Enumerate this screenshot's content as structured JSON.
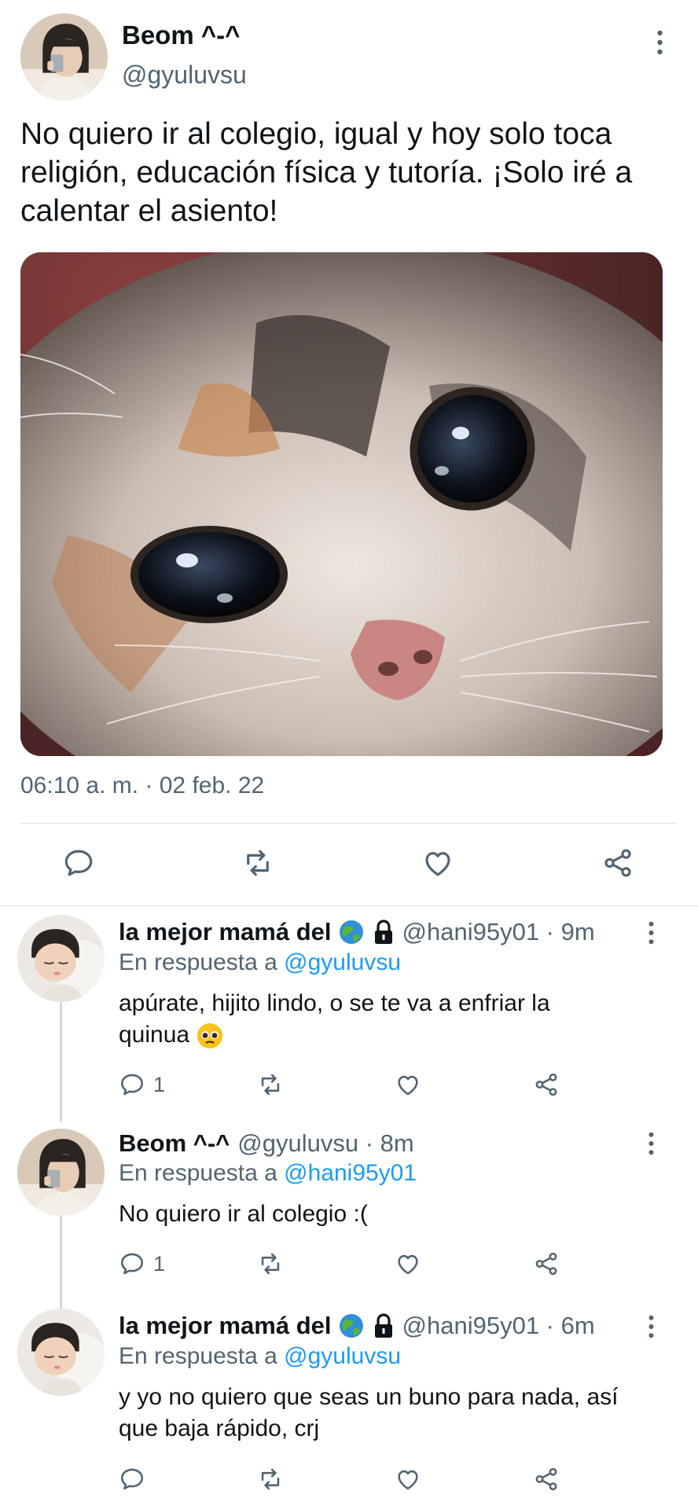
{
  "main_tweet": {
    "display_name": "Beom ^-^",
    "handle": "@gyuluvsu",
    "text": "No quiero ir al colegio, igual y hoy solo toca religión, educación física y tutoría. ¡Solo iré a calentar el asiento!",
    "image_icon": "crying-cat-photo",
    "timestamp": "06:10 a. m. · 02 feb. 22",
    "actions": [
      "reply-icon",
      "retweet-icon",
      "like-icon",
      "share-icon"
    ]
  },
  "replies": [
    {
      "display_name": "la mejor mamá del",
      "name_icons": [
        "globe-emoji",
        "lock-icon"
      ],
      "handle_time": "@hani95y01 · 9m",
      "reply_prefix": "En respuesta a",
      "reply_to": "@gyuluvsu",
      "text": "apúrate, hijito lindo, o se te va a enfriar la quinua",
      "text_emoji": "pleading-face-emoji",
      "reply_count": "1"
    },
    {
      "display_name": "Beom ^-^",
      "handle_time": "@gyuluvsu · 8m",
      "reply_prefix": "En respuesta a",
      "reply_to": "@hani95y01",
      "text": "No quiero ir al colegio :(",
      "reply_count": "1"
    },
    {
      "display_name": "la mejor mamá del",
      "name_icons": [
        "globe-emoji",
        "lock-icon"
      ],
      "handle_time": "@hani95y01 · 6m",
      "reply_prefix": "En respuesta a",
      "reply_to": "@gyuluvsu",
      "text": "y yo no quiero que seas un buno para nada, así que baja rápido, crj",
      "reply_count": ""
    }
  ],
  "colors": {
    "link": "#1d9bf0",
    "secondary": "#536471",
    "text": "#0f1419",
    "divider": "#dfe3e6"
  }
}
